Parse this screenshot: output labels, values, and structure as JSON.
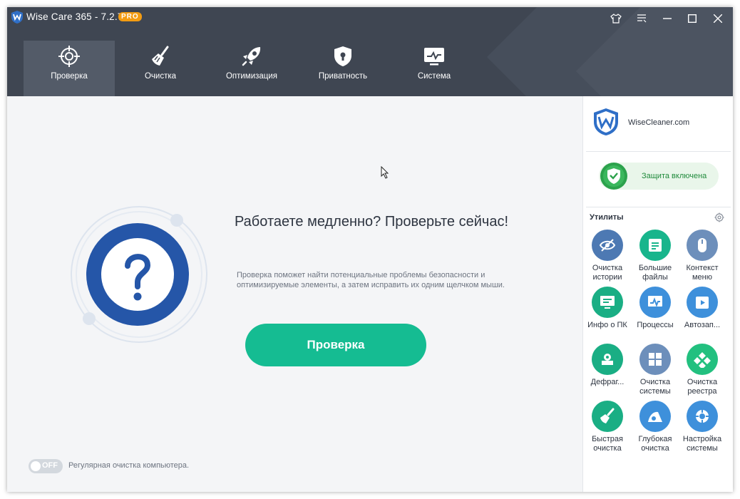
{
  "titlebar": {
    "title": "Wise Care 365 - 7.2.7",
    "badge": "PRO"
  },
  "nav": {
    "tabs": [
      {
        "label": "Проверка",
        "icon": "target-icon",
        "active": true
      },
      {
        "label": "Очистка",
        "icon": "broom-icon",
        "active": false
      },
      {
        "label": "Оптимизация",
        "icon": "rocket-icon",
        "active": false
      },
      {
        "label": "Приватность",
        "icon": "shield-lock-icon",
        "active": false
      },
      {
        "label": "Система",
        "icon": "monitor-icon",
        "active": false
      }
    ]
  },
  "main": {
    "headline": "Работаете медленно? Проверьте сейчас!",
    "description": "Проверка поможет найти потенциальные проблемы безопасности и оптимизируемые элементы, а затем исправить их одним щелчком мыши.",
    "scan_button": "Проверка",
    "toggle_state": "OFF",
    "toggle_label": "Регулярная очистка компьютера."
  },
  "sidebar": {
    "brand": "WiseCleaner.com",
    "protection": "Защита включена",
    "utilities_title": "Утилиты",
    "tools": [
      {
        "label": "Очистка истории",
        "icon": "eye-off-icon",
        "color": "#4d79b3"
      },
      {
        "label": "Большие файлы",
        "icon": "files-icon",
        "color": "#18b58c"
      },
      {
        "label": "Контекст меню",
        "icon": "mouse-icon",
        "color": "#6d8fbb"
      },
      {
        "label": "Инфо о ПК",
        "icon": "pc-info-icon",
        "color": "#1aae84"
      },
      {
        "label": "Процессы",
        "icon": "process-icon",
        "color": "#3e90db"
      },
      {
        "label": "Автозап...",
        "icon": "startup-icon",
        "color": "#3e90db"
      },
      {
        "label": "Дефраг...",
        "icon": "defrag-icon",
        "color": "#1aae84"
      },
      {
        "label": "Очистка системы",
        "icon": "windows-icon",
        "color": "#6d8fbb"
      },
      {
        "label": "Очистка реестра",
        "icon": "registry-icon",
        "color": "#22c07f"
      },
      {
        "label": "Быстрая очистка",
        "icon": "quick-clean-icon",
        "color": "#1aae84"
      },
      {
        "label": "Глубокая очистка",
        "icon": "deep-clean-icon",
        "color": "#3e90db"
      },
      {
        "label": "Настройка системы",
        "icon": "system-tune-icon",
        "color": "#3e90db"
      }
    ]
  },
  "colors": {
    "header": "#3f4652",
    "accent_green": "#15bc92",
    "scan_blue": "#2556a8"
  }
}
